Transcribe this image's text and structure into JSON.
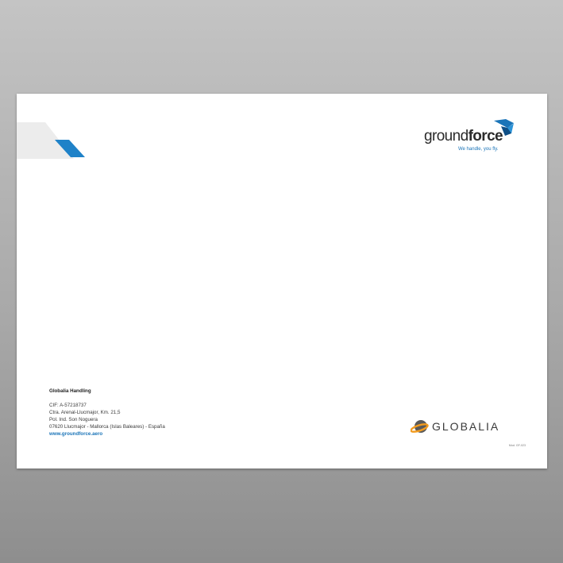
{
  "brand": {
    "name_light": "ground",
    "name_bold": "force",
    "tagline": "We handle, you fly.",
    "colors": {
      "blue": "#1a74b8",
      "dark": "#2b2b2b",
      "light_gray": "#ececec",
      "orange": "#f29b1f"
    }
  },
  "address": {
    "company": "Globalia Handling",
    "lines": [
      "CIF: A-57218737",
      "Ctra. Arenal-Llucmajor, Km. 21,5",
      "Pol. Ind. Son Noguera",
      "07620 Llucmajor - Mallorca (Islas Baleares) - España"
    ],
    "website": "www.groundforce.aero"
  },
  "parent_brand": {
    "name": "GLOBALIA"
  },
  "footer": {
    "code": "Mod. GF-023"
  },
  "icons": {
    "brand_mark": "groundforce-plane-icon",
    "parent_mark": "globalia-globe-icon"
  }
}
